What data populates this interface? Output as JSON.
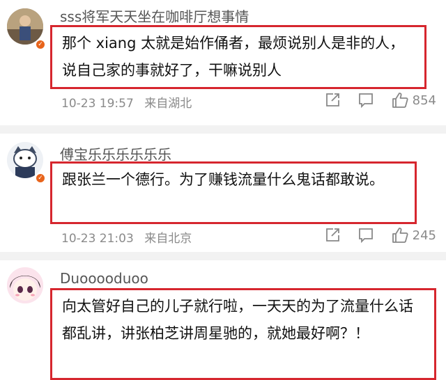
{
  "comments": [
    {
      "username": "sss将军天天坐在咖啡厅想事情",
      "text": "那个 xiang 太就是始作俑者，最烦说别人是非的人，说自己家的事就好了，干嘛说别人",
      "time": "10-23 19:57",
      "location": "来自湖北",
      "likes": "854"
    },
    {
      "username": "傅宝乐乐乐乐乐乐",
      "text": "跟张兰一个德行。为了赚钱流量什么鬼话都敢说。",
      "time": "10-23 21:03",
      "location": "来自北京",
      "likes": "245"
    },
    {
      "username": "Duooooduoo",
      "text": "向太管好自己的儿子就行啦，一天天的为了流量什么话都乱讲，讲张柏芝讲周星驰的，就她最好啊？！"
    }
  ],
  "colors": {
    "highlight_border": "#d6262e",
    "badge": "#e8641b",
    "meta_text": "#8a8a8a"
  },
  "icons": [
    "share-icon",
    "comment-icon",
    "like-icon"
  ]
}
